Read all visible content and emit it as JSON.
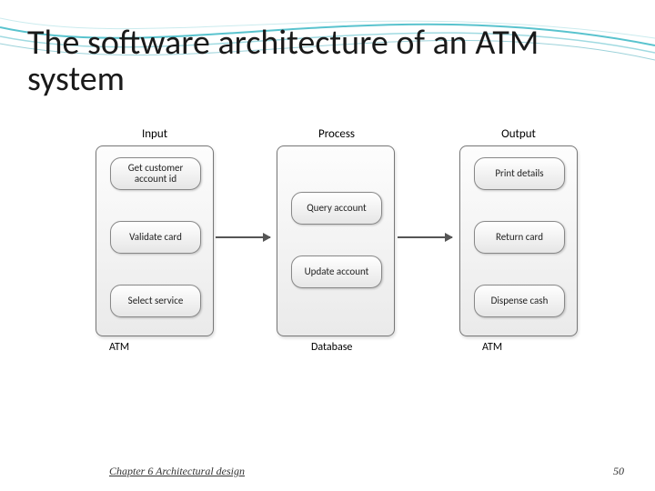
{
  "title": "The software architecture of an ATM system",
  "columns": {
    "input": {
      "header": "Input",
      "footer": "ATM",
      "items": [
        "Get customer account id",
        "Validate card",
        "Select service"
      ]
    },
    "process": {
      "header": "Process",
      "footer": "Database",
      "items": [
        "Query account",
        "Update account"
      ]
    },
    "output": {
      "header": "Output",
      "footer": "ATM",
      "items": [
        "Print details",
        "Return card",
        "Dispense cash"
      ]
    }
  },
  "footer": {
    "chapter": "Chapter 6 Architectural design",
    "page": "50"
  }
}
